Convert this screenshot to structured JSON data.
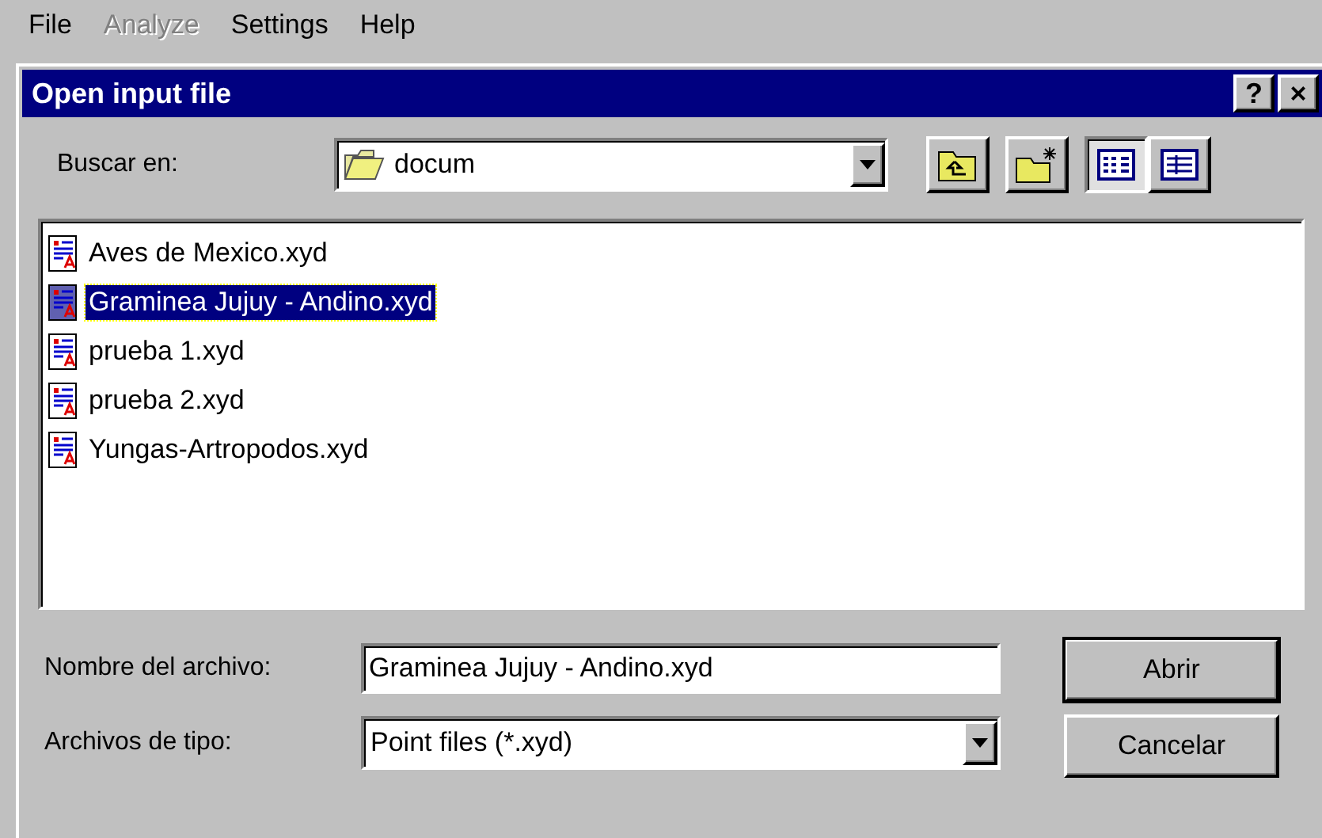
{
  "menu": [
    {
      "label": "File",
      "disabled": false
    },
    {
      "label": "Analyze",
      "disabled": true
    },
    {
      "label": "Settings",
      "disabled": false
    },
    {
      "label": "Help",
      "disabled": false
    }
  ],
  "dialog": {
    "title": "Open input file",
    "help_button": "?",
    "close_button": "×"
  },
  "look_in": {
    "label": "Buscar en:",
    "value": "docum"
  },
  "view_buttons": [
    {
      "kind": "list",
      "selected": true
    },
    {
      "kind": "details",
      "selected": false
    }
  ],
  "files": [
    {
      "name": "Aves de Mexico.xyd",
      "selected": false
    },
    {
      "name": "Graminea Jujuy - Andino.xyd",
      "selected": true
    },
    {
      "name": "prueba 1.xyd",
      "selected": false
    },
    {
      "name": "prueba 2.xyd",
      "selected": false
    },
    {
      "name": "Yungas-Artropodos.xyd",
      "selected": false
    }
  ],
  "file_name": {
    "label": "Nombre del archivo:",
    "value": "Graminea Jujuy - Andino.xyd"
  },
  "file_type": {
    "label": "Archivos de tipo:",
    "value": "Point files (*.xyd)"
  },
  "buttons": [
    {
      "label": "Abrir",
      "default": true
    },
    {
      "label": "Cancelar",
      "default": false
    }
  ]
}
